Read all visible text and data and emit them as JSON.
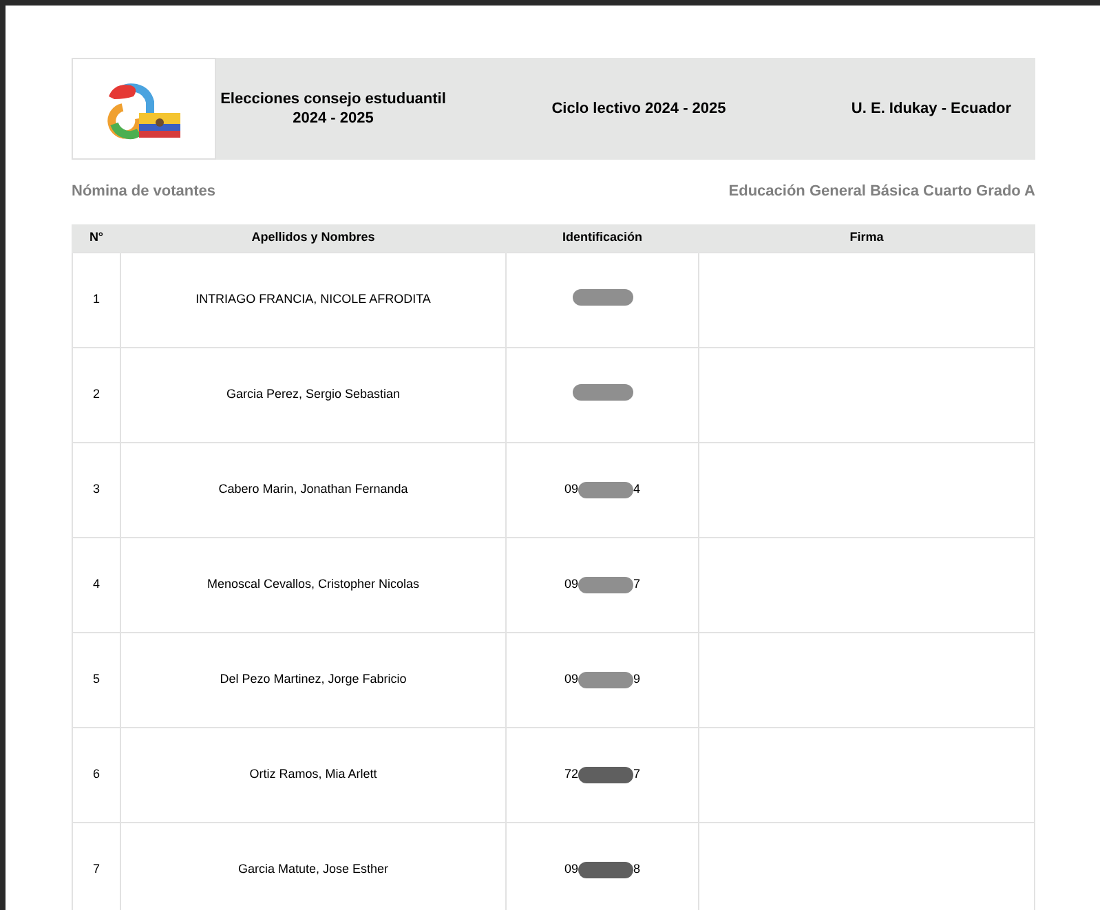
{
  "header": {
    "title": [
      "Elecciones consejo estuduantil",
      "2024 - 2025"
    ],
    "cycle": "Ciclo lectivo 2024 - 2025",
    "school": "U. E. Idukay - Ecuador"
  },
  "subtitle": {
    "left": "Nómina de votantes",
    "right": "Educación General Básica Cuarto Grado A"
  },
  "table": {
    "columns": [
      "N°",
      "Apellidos y Nombres",
      "Identificación",
      "Firma"
    ],
    "rows": [
      {
        "number": "1",
        "name": "INTRIAGO FRANCIA, NICOLE AFRODITA",
        "color": "#8f8f8f"
      },
      {
        "number": "2",
        "name": "Garcia Perez, Sergio Sebastian",
        "color": "#8f8f8f"
      },
      {
        "number": "3",
        "name": "Cabero Marin, Jonathan Fernanda",
        "id_prefix": "09",
        "id_suffix": "4",
        "color": "#8f8f8f"
      },
      {
        "number": "4",
        "name": "Menoscal Cevallos, Cristopher Nicolas",
        "id_prefix": "09",
        "id_suffix": "7",
        "color": "#8f8f8f"
      },
      {
        "number": "5",
        "name": "Del Pezo Martinez, Jorge Fabricio",
        "id_prefix": "09",
        "id_suffix": "9",
        "color": "#8f8f8f"
      },
      {
        "number": "6",
        "name": "Ortiz Ramos, Mia Arlett",
        "id_prefix": "72",
        "id_suffix": "7",
        "color": "#5f5f5f"
      },
      {
        "number": "7",
        "name": "Garcia Matute, Jose Esther",
        "id_prefix": "09",
        "id_suffix": "8",
        "color": "#5f5f5f"
      }
    ]
  }
}
